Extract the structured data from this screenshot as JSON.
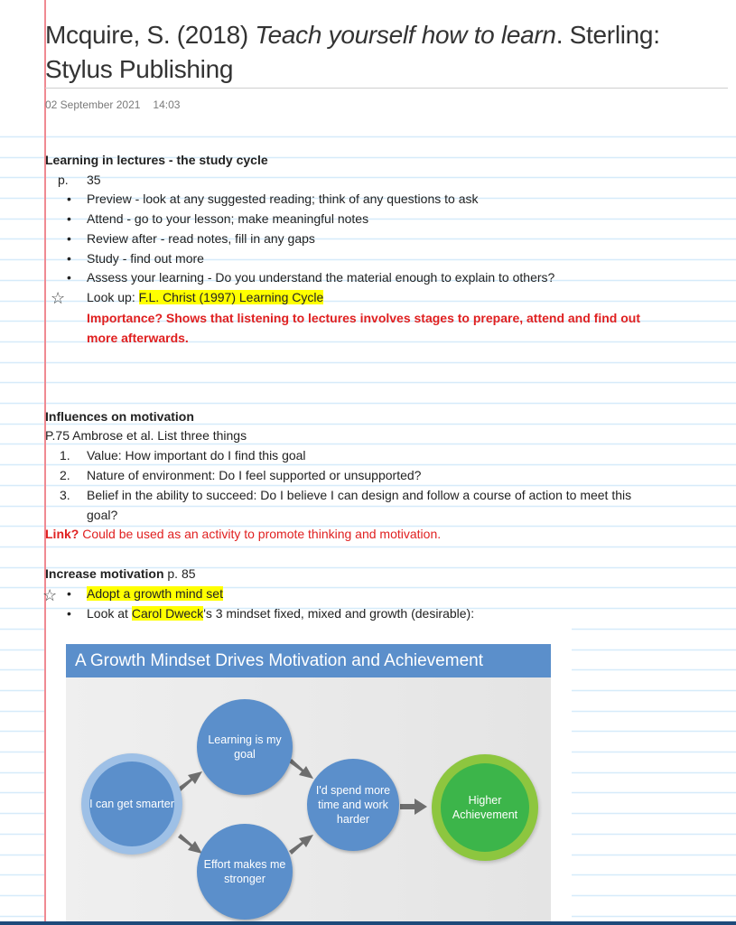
{
  "page": {
    "title_author": "Mcquire, S. (2018) ",
    "title_book": "Teach yourself how to learn",
    "title_rest": ". Sterling: Stylus Publishing",
    "date": "02 September 2021",
    "time": "14:03"
  },
  "section1": {
    "heading": "Learning in lectures - the study cycle",
    "page_label": "p.",
    "page_num": "35",
    "bullets": [
      "Preview - look at any suggested reading; think of any questions to ask",
      "Attend - go to your lesson; make meaningful notes",
      "Review after - read notes, fill in any gaps",
      "Study - find out more",
      "Assess your learning - Do you understand the material enough to explain to others?"
    ],
    "lookup_prefix": "Look up: ",
    "lookup_highlight": "F.L. Christ (1997) Learning Cycle",
    "importance_line1": "Importance? Shows that listening to lectures involves stages to prepare, attend and find out",
    "importance_line2": "more afterwards."
  },
  "section2": {
    "heading": "Influences on motivation",
    "subline": "P.75 Ambrose et al. List three things",
    "items": [
      {
        "num": "1.",
        "text": "Value: How important do I find this goal"
      },
      {
        "num": "2.",
        "text": "Nature of environment: Do I feel supported or unsupported?"
      },
      {
        "num": "3.",
        "text": "Belief in the ability to succeed: Do I believe I can design and follow a course of action to meet this"
      }
    ],
    "item3_cont": "goal?",
    "link_label": "Link?",
    "link_text": " Could be used as an activity to promote thinking and motivation."
  },
  "section3": {
    "heading_bold": "Increase motivation",
    "heading_rest": " p. 85",
    "bullet1": "Adopt a growth mind set",
    "bullet2_prefix": "Look at ",
    "bullet2_highlight": "Carol Dweck",
    "bullet2_rest": "'s 3 mindset fixed, mixed and growth (desirable):"
  },
  "diagram": {
    "title": "A Growth Mindset Drives Motivation and Achievement",
    "nodes": {
      "smarter": "I can get smarter",
      "learning": "Learning is my goal",
      "effort": "Effort makes me stronger",
      "spend": "I'd spend more time and work harder",
      "achievement": "Higher Achievement"
    }
  },
  "icons": {
    "star": "☆",
    "bullet": "•"
  },
  "colors": {
    "highlight": "#ffff00",
    "red_text": "#e02020",
    "rule_line": "#d6ebfa",
    "margin_line": "#f08a92",
    "diagram_blue": "#5b8fcb",
    "diagram_green": "#3cb54a"
  }
}
